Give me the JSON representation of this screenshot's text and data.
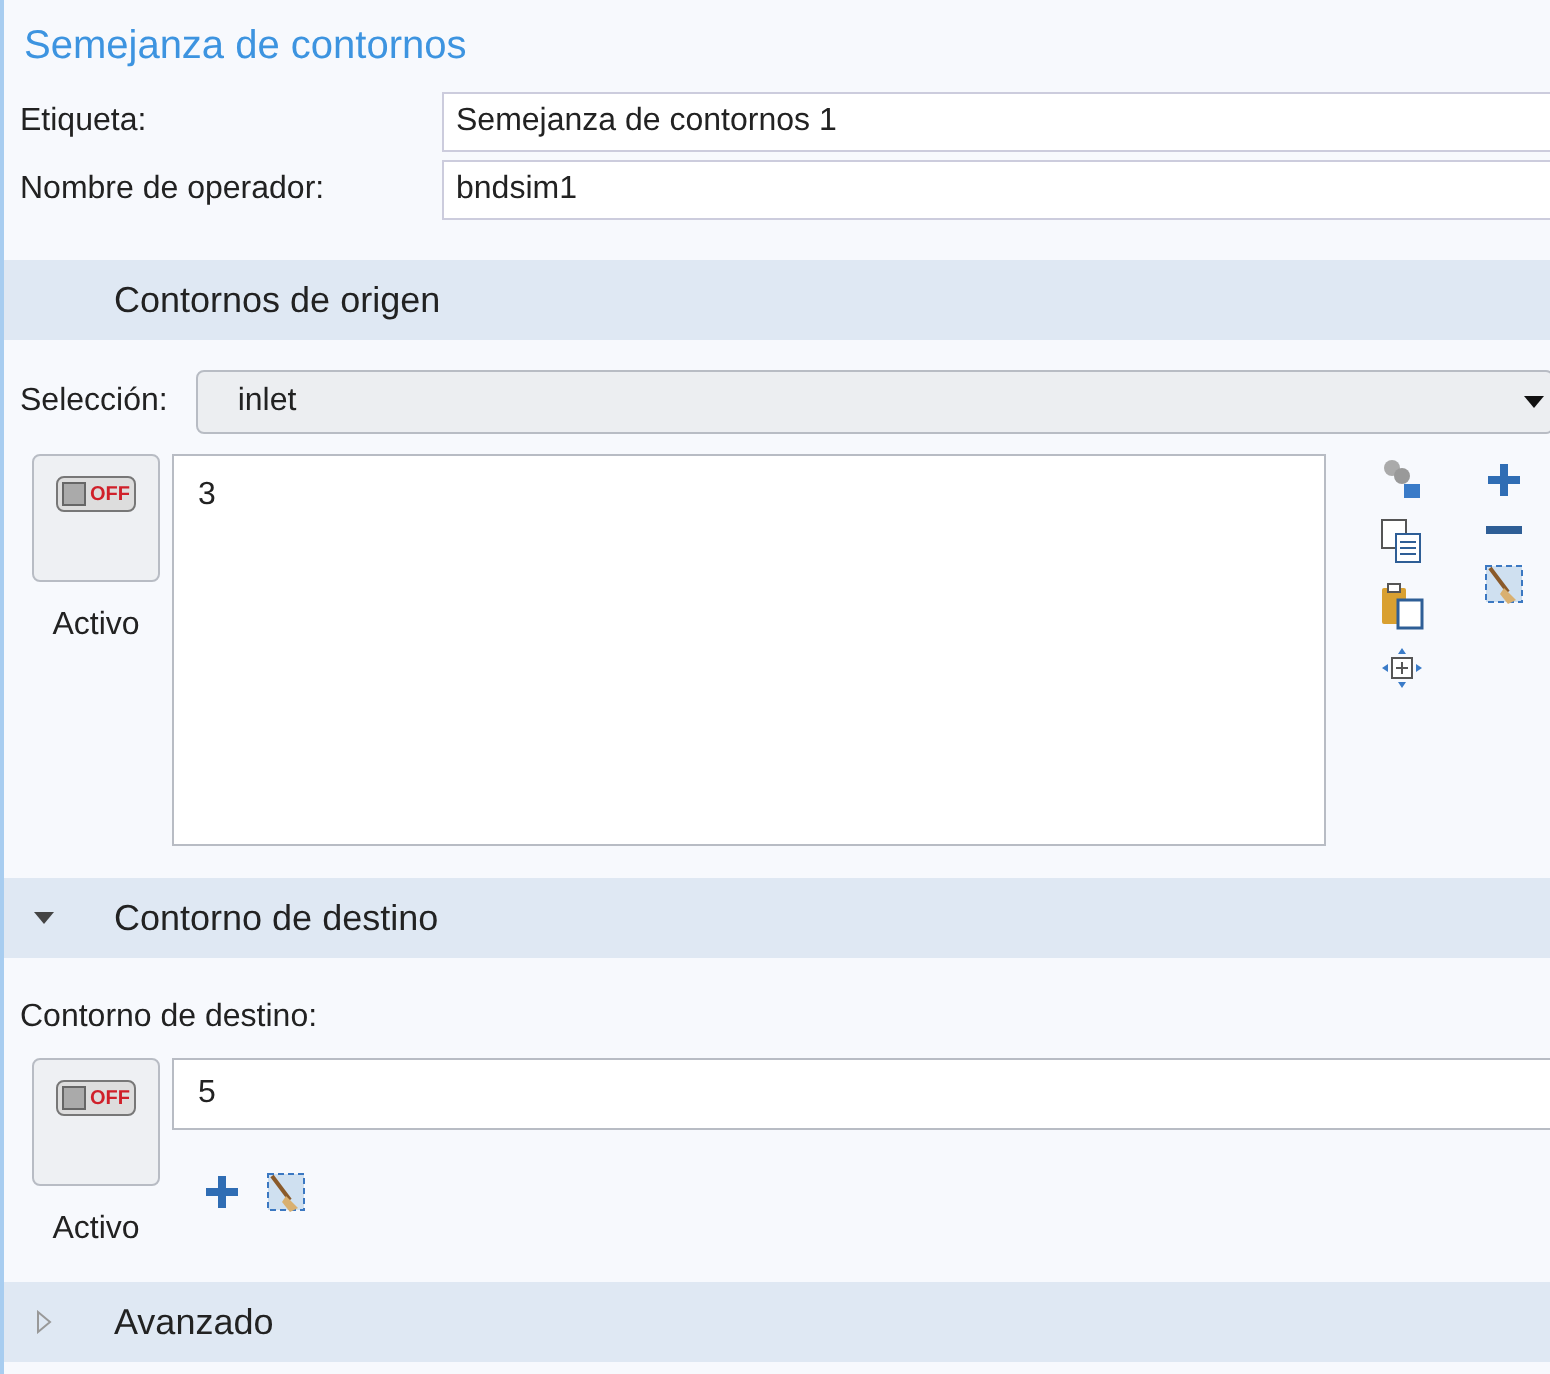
{
  "title": "Semejanza de contornos",
  "fields": [
    {
      "label": "Etiqueta:",
      "value": "Semejanza de contornos 1"
    },
    {
      "label": "Nombre de operador:",
      "value": "bndsim1"
    }
  ],
  "source_section": {
    "header": "Contornos de origen",
    "selection_label": "Selección:",
    "selection_value": "inlet",
    "toggle": {
      "text": "OFF",
      "on": false
    },
    "toggle_label": "Activo",
    "list_items": [
      "3"
    ]
  },
  "target_section": {
    "header": "Contorno de destino",
    "expanded": true,
    "field_label": "Contorno de destino:",
    "value": "5",
    "toggle": {
      "text": "OFF",
      "on": false
    },
    "toggle_label": "Activo"
  },
  "advanced_section": {
    "header": "Avanzado",
    "expanded": false
  }
}
